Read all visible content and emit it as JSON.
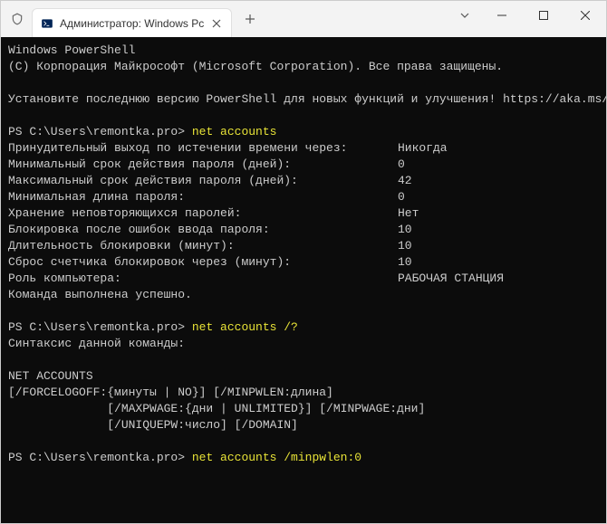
{
  "tab": {
    "title": "Администратор: Windows Pc"
  },
  "terminal": {
    "header1": "Windows PowerShell",
    "header2": "(C) Корпорация Майкрософт (Microsoft Corporation). Все права защищены.",
    "install_msg": "Установите последнюю версию PowerShell для новых функций и улучшения! https://aka.ms/PSWindows",
    "prompt": "PS C:\\Users\\remontka.pro> ",
    "cmd1": "net accounts",
    "rows": [
      {
        "label": "Принудительный выход по истечении времени через:",
        "val": "Никогда"
      },
      {
        "label": "Минимальный срок действия пароля (дней):",
        "val": "0"
      },
      {
        "label": "Максимальный срок действия пароля (дней):",
        "val": "42"
      },
      {
        "label": "Минимальная длина пароля:",
        "val": "0"
      },
      {
        "label": "Хранение неповторяющихся паролей:",
        "val": "Нет"
      },
      {
        "label": "Блокировка после ошибок ввода пароля:",
        "val": "10"
      },
      {
        "label": "Длительность блокировки (минут):",
        "val": "10"
      },
      {
        "label": "Сброс счетчика блокировок через (минут):",
        "val": "10"
      },
      {
        "label": "Роль компьютера:",
        "val": "РАБОЧАЯ СТАНЦИЯ"
      }
    ],
    "success": "Команда выполнена успешно.",
    "cmd2": "net accounts /?",
    "syntax": "Синтаксис данной команды:",
    "netaccounts_hdr": "NET ACCOUNTS",
    "usage1": "[/FORCELOGOFF:{минуты | NO}] [/MINPWLEN:длина]",
    "usage2": "              [/MAXPWAGE:{дни | UNLIMITED}] [/MINPWAGE:дни]",
    "usage3": "              [/UNIQUEPW:число] [/DOMAIN]",
    "cmd3": "net accounts /minpwlen:0"
  }
}
